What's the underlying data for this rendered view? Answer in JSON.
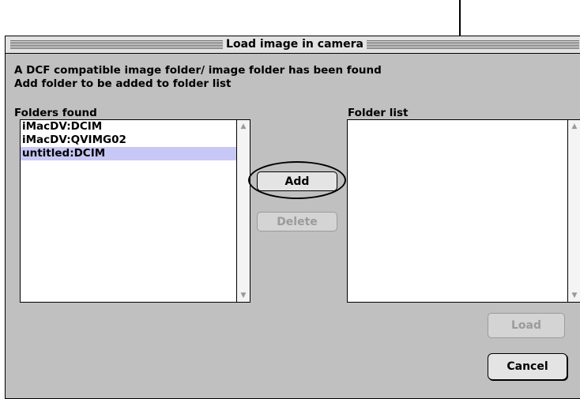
{
  "dialog": {
    "title": "Load image in camera",
    "message_line1": "A DCF compatible image folder/ image folder has been found",
    "message_line2": "Add folder to be added to folder list",
    "folders_found_label": "Folders found",
    "folder_list_label": "Folder list",
    "folders_found": [
      {
        "label": "iMacDV:DCIM",
        "selected": false
      },
      {
        "label": "iMacDV:QVIMG02",
        "selected": false
      },
      {
        "label": "untitled:DCIM",
        "selected": true
      }
    ],
    "folder_list": [],
    "buttons": {
      "add": "Add",
      "delete": "Delete",
      "load": "Load",
      "cancel": "Cancel"
    },
    "colors": {
      "window_bg": "#c0c0c0",
      "selection": "#c8c8f6"
    },
    "icons": [
      "scroll-up-arrow-icon",
      "scroll-down-arrow-icon"
    ]
  }
}
